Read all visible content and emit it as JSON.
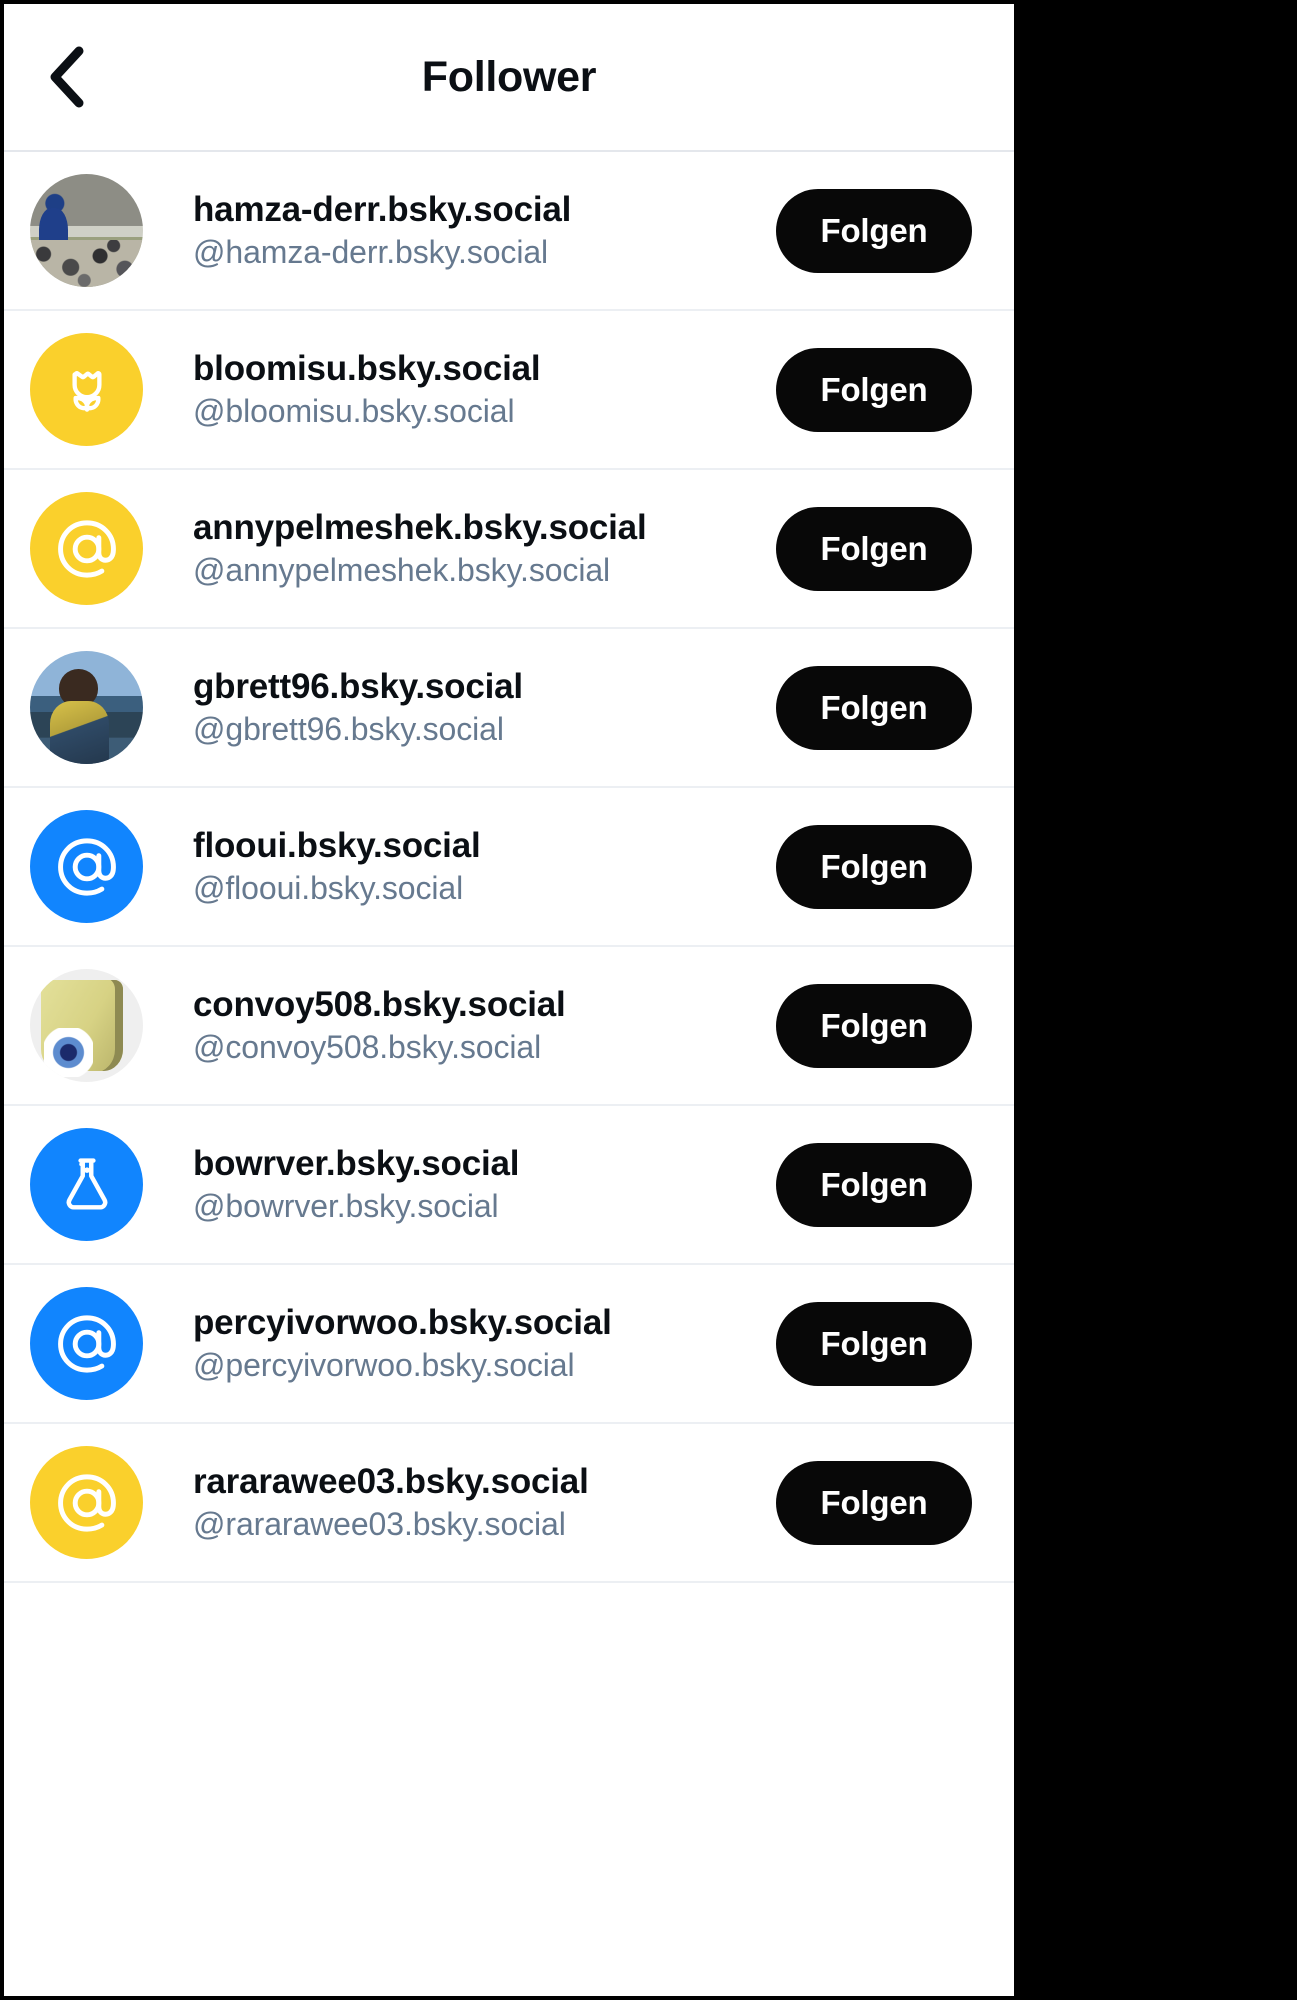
{
  "app": {
    "name": "bluesky-follower-list",
    "background_color": "#000000",
    "surface_color": "#ffffff"
  },
  "header": {
    "title": "Follower",
    "back_icon": "chevron-left-icon",
    "back_label": "Zurück"
  },
  "colors": {
    "text_primary": "#0b0f14",
    "text_secondary": "#66798f",
    "button_background": "#080808",
    "button_text": "#ffffff",
    "avatar_yellow": "#fad02c",
    "avatar_blue": "#1185fe",
    "divider": "#eceff3"
  },
  "list": {
    "follow_label": "Folgen",
    "rows": [
      {
        "display_name": "hamza-derr.bsky.social",
        "handle": "@hamza-derr.bsky.social",
        "avatar_type": "photo",
        "avatar_icon": "photo-avatar-hamza",
        "avatar_color": "",
        "follow_label": "Folgen"
      },
      {
        "display_name": "bloomisu.bsky.social",
        "handle": "@bloomisu.bsky.social",
        "avatar_type": "icon",
        "avatar_icon": "tulip-icon",
        "avatar_color": "#fad02c",
        "follow_label": "Folgen"
      },
      {
        "display_name": "annypelmeshek.bsky.social",
        "handle": "@annypelmeshek.bsky.social",
        "avatar_type": "icon",
        "avatar_icon": "at-sign-icon",
        "avatar_color": "#fad02c",
        "follow_label": "Folgen"
      },
      {
        "display_name": "gbrett96.bsky.social",
        "handle": "@gbrett96.bsky.social",
        "avatar_type": "photo",
        "avatar_icon": "photo-avatar-gbrett96",
        "avatar_color": "",
        "follow_label": "Folgen"
      },
      {
        "display_name": "flooui.bsky.social",
        "handle": "@flooui.bsky.social",
        "avatar_type": "icon",
        "avatar_icon": "at-sign-icon",
        "avatar_color": "#1185fe",
        "follow_label": "Folgen"
      },
      {
        "display_name": "convoy508.bsky.social",
        "handle": "@convoy508.bsky.social",
        "avatar_type": "photo",
        "avatar_icon": "photo-avatar-mug-eye",
        "avatar_color": "",
        "follow_label": "Folgen"
      },
      {
        "display_name": "bowrver.bsky.social",
        "handle": "@bowrver.bsky.social",
        "avatar_type": "icon",
        "avatar_icon": "flask-icon",
        "avatar_color": "#1185fe",
        "follow_label": "Folgen"
      },
      {
        "display_name": "percyivorwoo.bsky.social",
        "handle": "@percyivorwoo.bsky.social",
        "avatar_type": "icon",
        "avatar_icon": "at-sign-icon",
        "avatar_color": "#1185fe",
        "follow_label": "Folgen"
      },
      {
        "display_name": "rararawee03.bsky.social",
        "handle": "@rararawee03.bsky.social",
        "avatar_type": "icon",
        "avatar_icon": "at-sign-icon",
        "avatar_color": "#fad02c",
        "follow_label": "Folgen"
      }
    ]
  }
}
